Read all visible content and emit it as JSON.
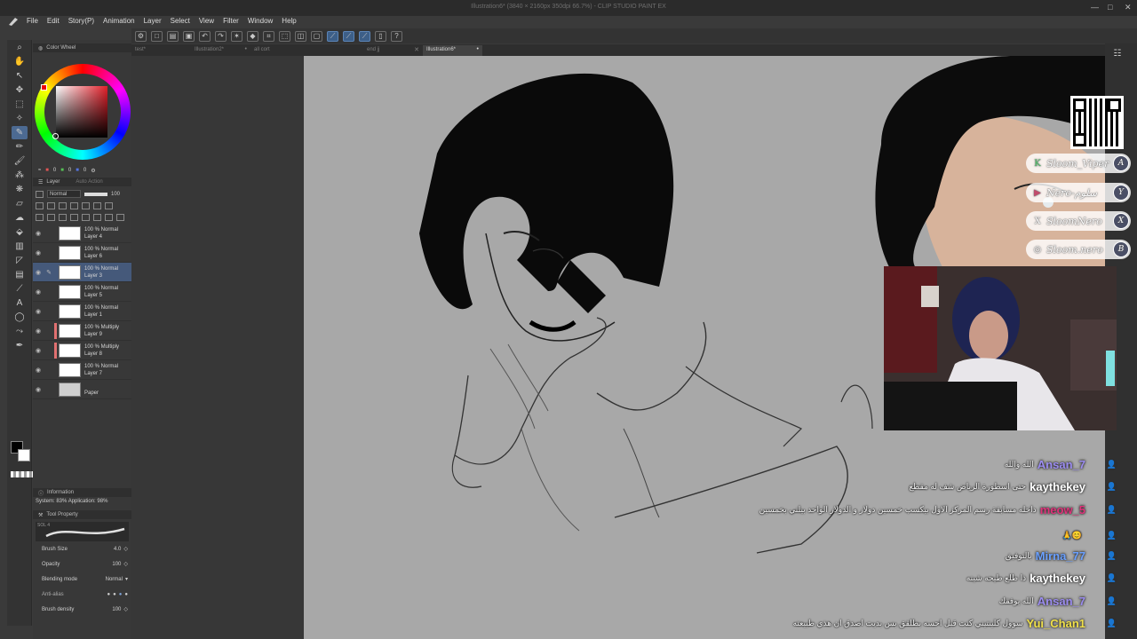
{
  "window": {
    "title": "Illustration6* (3840 × 2160px 350dpi 66.7%) - CLIP STUDIO PAINT EX",
    "controls": [
      "—",
      "□",
      "✕"
    ]
  },
  "menu": {
    "items": [
      "File",
      "Edit",
      "Story(P)",
      "Animation",
      "Layer",
      "Select",
      "View",
      "Filter",
      "Window",
      "Help"
    ]
  },
  "tabs": [
    {
      "label": "test*",
      "active": false
    },
    {
      "label": "Illustration2*",
      "active": false
    },
    {
      "label": "all cort",
      "active": false
    },
    {
      "label": "end jj",
      "active": false
    },
    {
      "label": "Illustration6*",
      "active": true
    }
  ],
  "color_panel": {
    "title": "Color Wheel",
    "rgb": [
      "0",
      "0",
      "0"
    ],
    "primary": "#000000",
    "secondary": "#ffffff"
  },
  "layer_panel": {
    "title": "Layer",
    "tab2": "Auto Action",
    "blend_mode": "Normal",
    "opacity": "100",
    "layers": [
      {
        "mode": "100 % Normal",
        "name": "Layer 4",
        "selected": false,
        "clip": ""
      },
      {
        "mode": "100 % Normal",
        "name": "Layer 6",
        "selected": false,
        "clip": ""
      },
      {
        "mode": "100 % Normal",
        "name": "Layer 3",
        "selected": true,
        "clip": ""
      },
      {
        "mode": "100 % Normal",
        "name": "Layer 5",
        "selected": false,
        "clip": ""
      },
      {
        "mode": "100 % Normal",
        "name": "Layer 1",
        "selected": false,
        "clip": ""
      },
      {
        "mode": "100 % Multiply",
        "name": "Layer 9",
        "selected": false,
        "clip": "#e07070"
      },
      {
        "mode": "100 % Multiply",
        "name": "Layer 8",
        "selected": false,
        "clip": "#e07070"
      },
      {
        "mode": "100 % Normal",
        "name": "Layer 7",
        "selected": false,
        "clip": ""
      },
      {
        "mode": "",
        "name": "Paper",
        "selected": false,
        "clip": "",
        "paper": true
      }
    ]
  },
  "info_panel": {
    "title": "Information",
    "system": "System: 83%",
    "application": "Application: 98%"
  },
  "tool_property": {
    "title": "Tool Property",
    "brush_name": "SOL 4",
    "brush_size_label": "Brush Size",
    "brush_size_value": "4.0",
    "opacity_label": "Opacity",
    "opacity_value": "100",
    "blending_label": "Blending mode",
    "blending_value": "Normal",
    "antialias_label": "Anti-alias",
    "density_label": "Brush density",
    "density_value": "100"
  },
  "overlay": {
    "socials": [
      {
        "icon": "K",
        "handle": "Sloom_Viper",
        "badge": "A",
        "color": "#53c26b"
      },
      {
        "icon": "▶",
        "handle": "Nero-سلوم",
        "badge": "Y",
        "color": "#c24b6b"
      },
      {
        "icon": "X",
        "handle": "SloomNero",
        "badge": "X",
        "color": "#444444"
      },
      {
        "icon": "◎",
        "handle": "Sloom.nero",
        "badge": "B",
        "color": "#c26ab2"
      }
    ]
  },
  "chat": [
    {
      "name": "Ansan_7",
      "message": "الله والله",
      "color": "#9b8cf0"
    },
    {
      "name": "kaythekey",
      "message": "حتى اسطورة الرياض شف له مقطع",
      "color": "#ffffff"
    },
    {
      "name": "meow_5",
      "message": "داخله مسابقة رسم المركز الاول بيكسب خمسين دولار و الدولار الواحد بيلني بخمسين",
      "color": "#e0327a"
    },
    {
      "name": "",
      "message": "🙏😊",
      "color": "#ffffff"
    },
    {
      "name": "Mirna_77",
      "message": "بالتوفيق",
      "color": "#6aa0ff"
    },
    {
      "name": "kaythekey",
      "message": "ذا طلع طيحه شينه",
      "color": "#ffffff"
    },
    {
      "name": "Ansan_7",
      "message": "الله يوفقك",
      "color": "#9b8cf0"
    },
    {
      "name": "Yui_Chan1",
      "message": "سوول كلينتيني كنت قبل احسه بطلقق بس بديت اصدق ان هذي طبيعته",
      "color": "#f0e04a"
    }
  ]
}
